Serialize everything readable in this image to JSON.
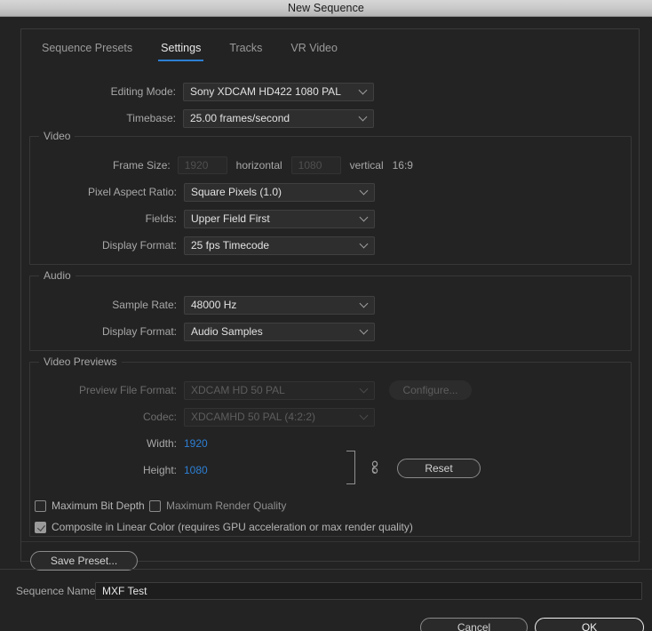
{
  "window": {
    "title": "New Sequence"
  },
  "tabs": [
    {
      "label": "Sequence Presets",
      "active": false
    },
    {
      "label": "Settings",
      "active": true
    },
    {
      "label": "Tracks",
      "active": false
    },
    {
      "label": "VR Video",
      "active": false
    }
  ],
  "top_fields": {
    "editing_mode_label": "Editing Mode:",
    "editing_mode_value": "Sony XDCAM HD422 1080 PAL",
    "timebase_label": "Timebase:",
    "timebase_value": "25.00  frames/second"
  },
  "video_group": {
    "title": "Video",
    "frame_size_label": "Frame Size:",
    "frame_width_value": "1920",
    "horizontal_label": "horizontal",
    "frame_height_value": "1080",
    "vertical_label": "vertical",
    "aspect_ratio_text": "16:9",
    "pixel_aspect_label": "Pixel Aspect Ratio:",
    "pixel_aspect_value": "Square Pixels (1.0)",
    "fields_label": "Fields:",
    "fields_value": "Upper Field First",
    "display_format_label": "Display Format:",
    "display_format_value": "25 fps Timecode"
  },
  "audio_group": {
    "title": "Audio",
    "sample_rate_label": "Sample Rate:",
    "sample_rate_value": "48000 Hz",
    "display_format_label": "Display Format:",
    "display_format_value": "Audio Samples"
  },
  "previews_group": {
    "title": "Video Previews",
    "preview_file_format_label": "Preview File Format:",
    "preview_file_format_value": "XDCAM HD 50 PAL",
    "configure_label": "Configure...",
    "codec_label": "Codec:",
    "codec_value": "XDCAMHD 50 PAL (4:2:2)",
    "width_label": "Width:",
    "width_value": "1920",
    "height_label": "Height:",
    "height_value": "1080",
    "reset_label": "Reset"
  },
  "checkboxes": {
    "max_bit_depth_label": "Maximum Bit Depth",
    "max_bit_depth_checked": false,
    "max_render_quality_label": "Maximum Render Quality",
    "max_render_quality_checked": false,
    "composite_linear_label": "Composite in Linear Color (requires GPU acceleration or max render quality)",
    "composite_linear_checked": true
  },
  "save_preset_label": "Save Preset...",
  "footer": {
    "sequence_name_label": "Sequence Name:",
    "sequence_name_value": "MXF Test",
    "cancel_label": "Cancel",
    "ok_label": "OK"
  },
  "colors": {
    "accent_blue": "#2d7fd4",
    "dialog_bg": "#232323",
    "text": "#c8c8c8"
  }
}
